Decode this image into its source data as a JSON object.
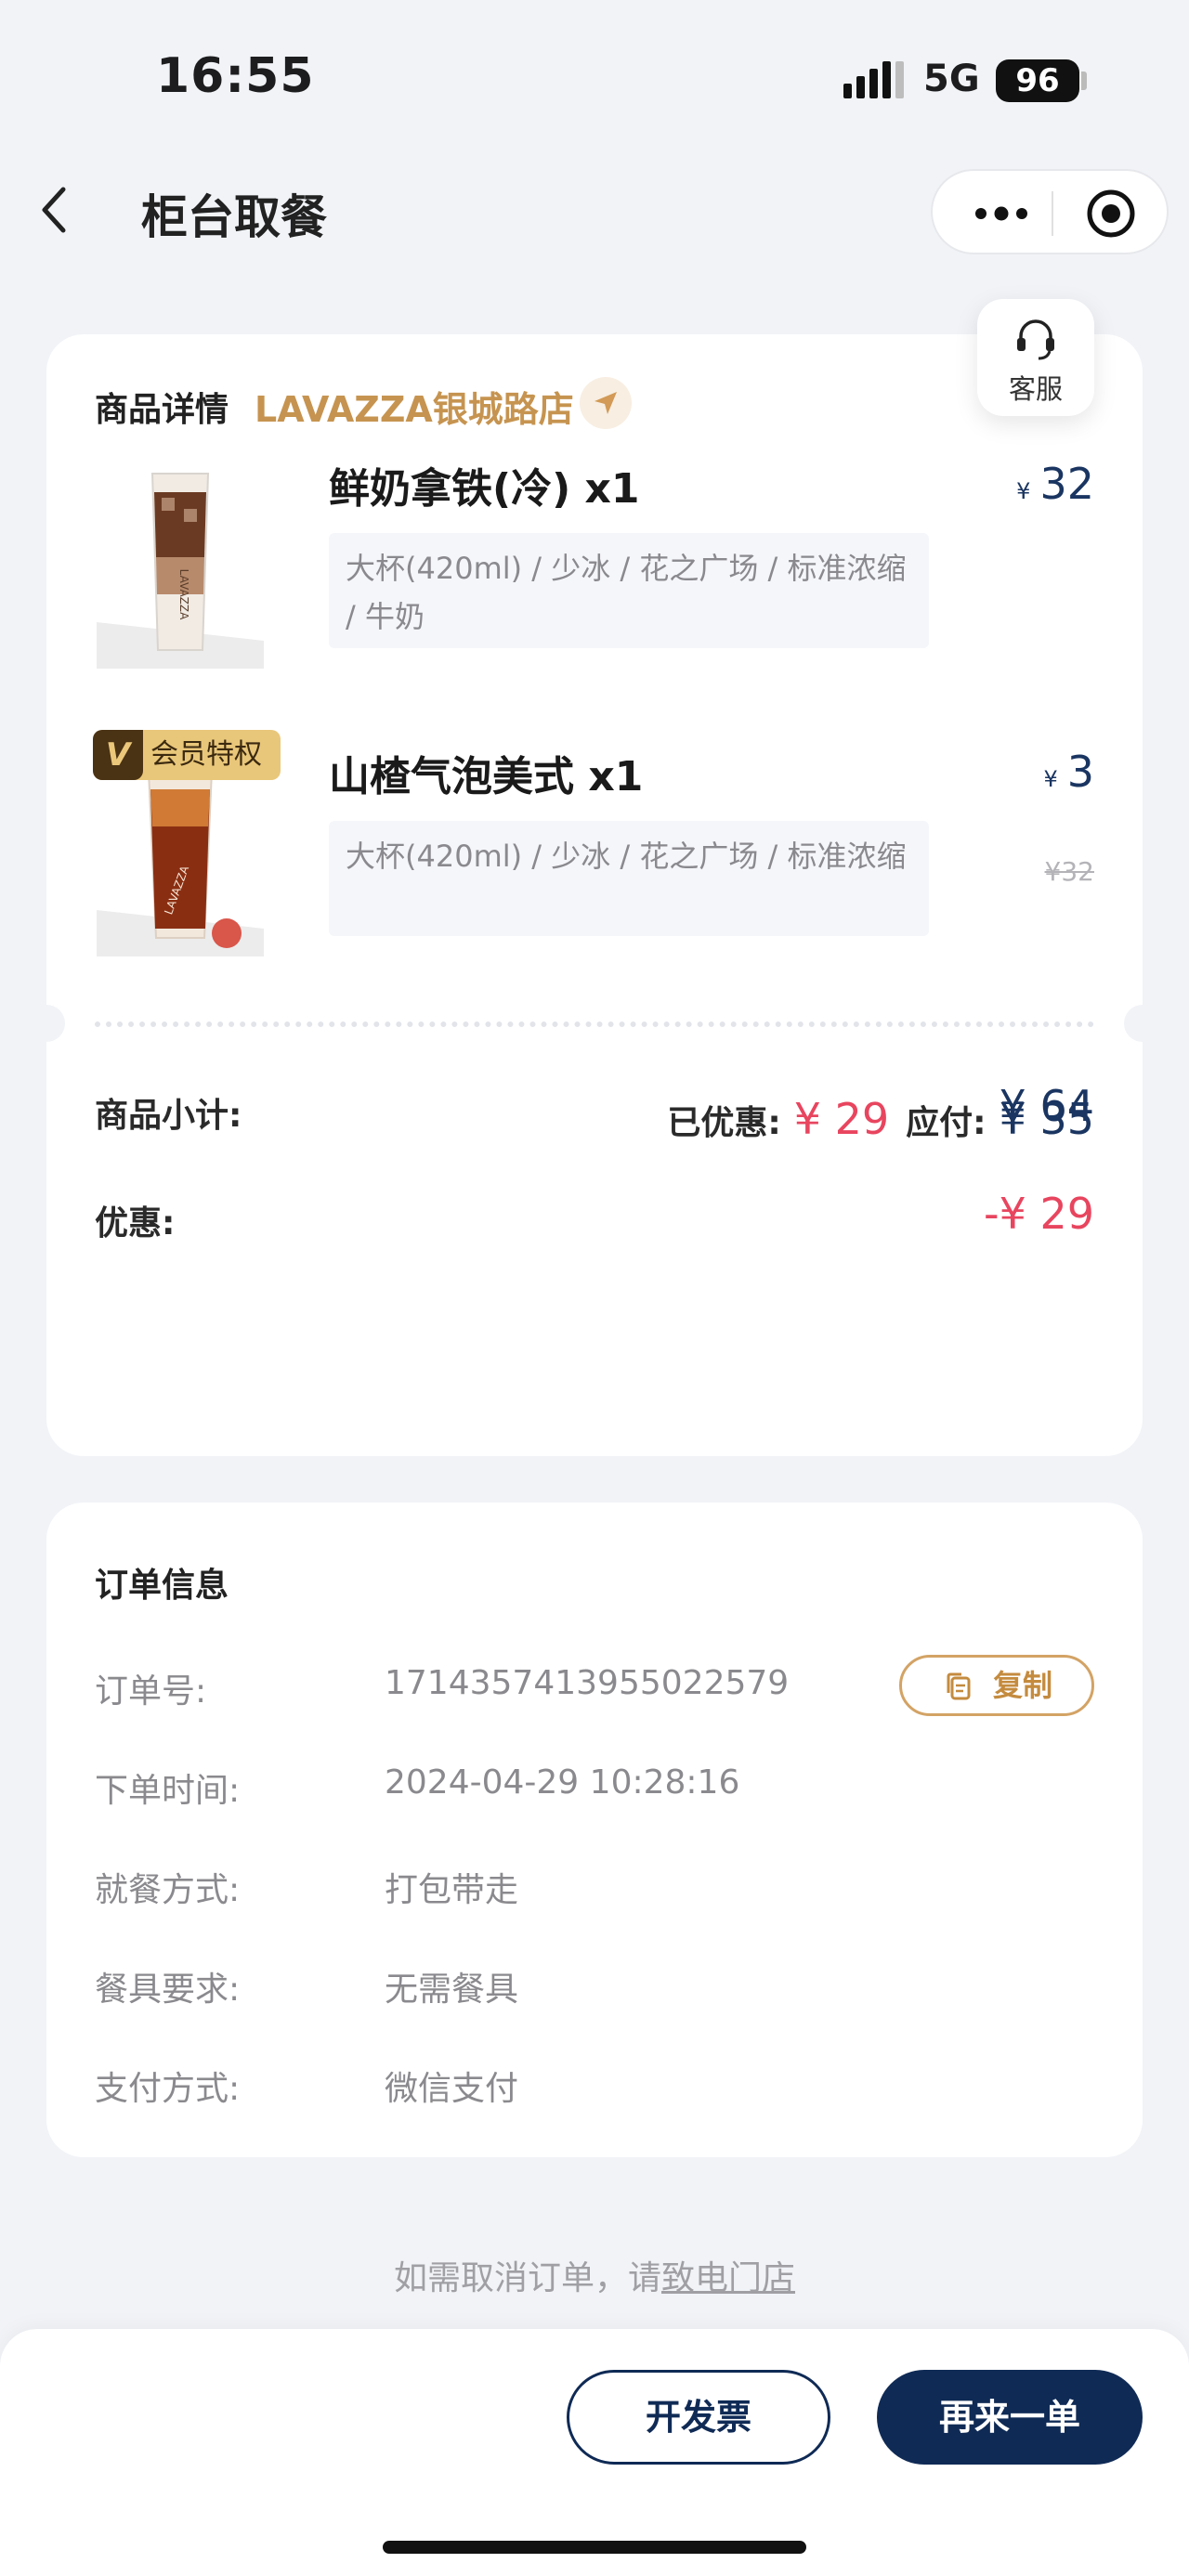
{
  "status_bar": {
    "time": "16:55",
    "network": "5G",
    "battery": "96"
  },
  "nav": {
    "title": "柜台取餐"
  },
  "customer_service": {
    "label": "客服"
  },
  "products_card": {
    "title": "商品详情",
    "store": "LAVAZZA银城路店",
    "items": [
      {
        "name": "鲜奶拿铁(冷) x1",
        "options": "大杯(420ml) / 少冰 / 花之广场 / 标准浓缩 / 牛奶",
        "currency": "¥",
        "price": "32"
      },
      {
        "badge_letter": "V",
        "badge": "会员特权",
        "name": "山楂气泡美式 x1",
        "options": "大杯(420ml) / 少冰 / 花之广场 / 标准浓缩",
        "currency": "¥",
        "price": "3",
        "original_price": "¥32"
      }
    ],
    "subtotal_label": "商品小计:",
    "subtotal_value": "¥ 64",
    "discount_label": "优惠:",
    "discount_value": "-¥ 29",
    "saved_label": "已优惠:",
    "saved_value": "¥ 29",
    "payable_label": "应付:",
    "payable_value": "¥ 35"
  },
  "order_info": {
    "title": "订单信息",
    "rows": [
      {
        "label": "订单号:",
        "value": "1714357413955022579"
      },
      {
        "label": "下单时间:",
        "value": "2024-04-29 10:28:16"
      },
      {
        "label": "就餐方式:",
        "value": "打包带走"
      },
      {
        "label": "餐具要求:",
        "value": "无需餐具"
      },
      {
        "label": "支付方式:",
        "value": "微信支付"
      }
    ],
    "copy_label": "复制"
  },
  "cancel_note": {
    "text": "如需取消订单，请",
    "link": "致电门店"
  },
  "actions": {
    "invoice": "开发票",
    "reorder": "再来一单"
  },
  "colors": {
    "navy": "#0f2a55",
    "gold": "#c69450",
    "red": "#e8455f",
    "background": "#f1f3f7"
  }
}
